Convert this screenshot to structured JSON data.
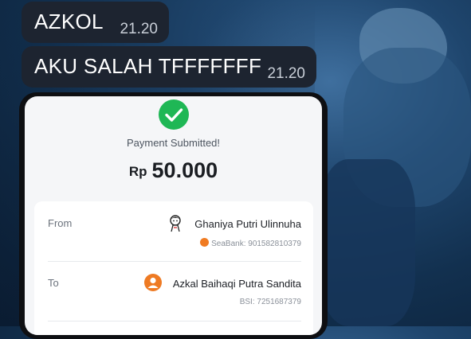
{
  "messages": [
    {
      "text": "AZKOL",
      "time": "21.20"
    },
    {
      "text": "AKU SALAH TFFFFFFF",
      "time": "21.20"
    }
  ],
  "receipt": {
    "status": "Payment Submitted!",
    "currency": "Rp",
    "amount": "50.000",
    "from": {
      "label": "From",
      "name": "Ghaniya Putri Ulinnuha",
      "bank": "SeaBank: 901582810379"
    },
    "to": {
      "label": "To",
      "name": "Azkal Baihaqi Putra Sandita",
      "bank": "BSI: 7251687379"
    }
  },
  "colors": {
    "bubble": "#1d2430",
    "success": "#1fb755",
    "avatar": "#ee7a23"
  },
  "icons": [
    "check-circle-icon",
    "cartoon-avatar-icon",
    "seabank-logo-icon",
    "user-avatar-icon"
  ]
}
